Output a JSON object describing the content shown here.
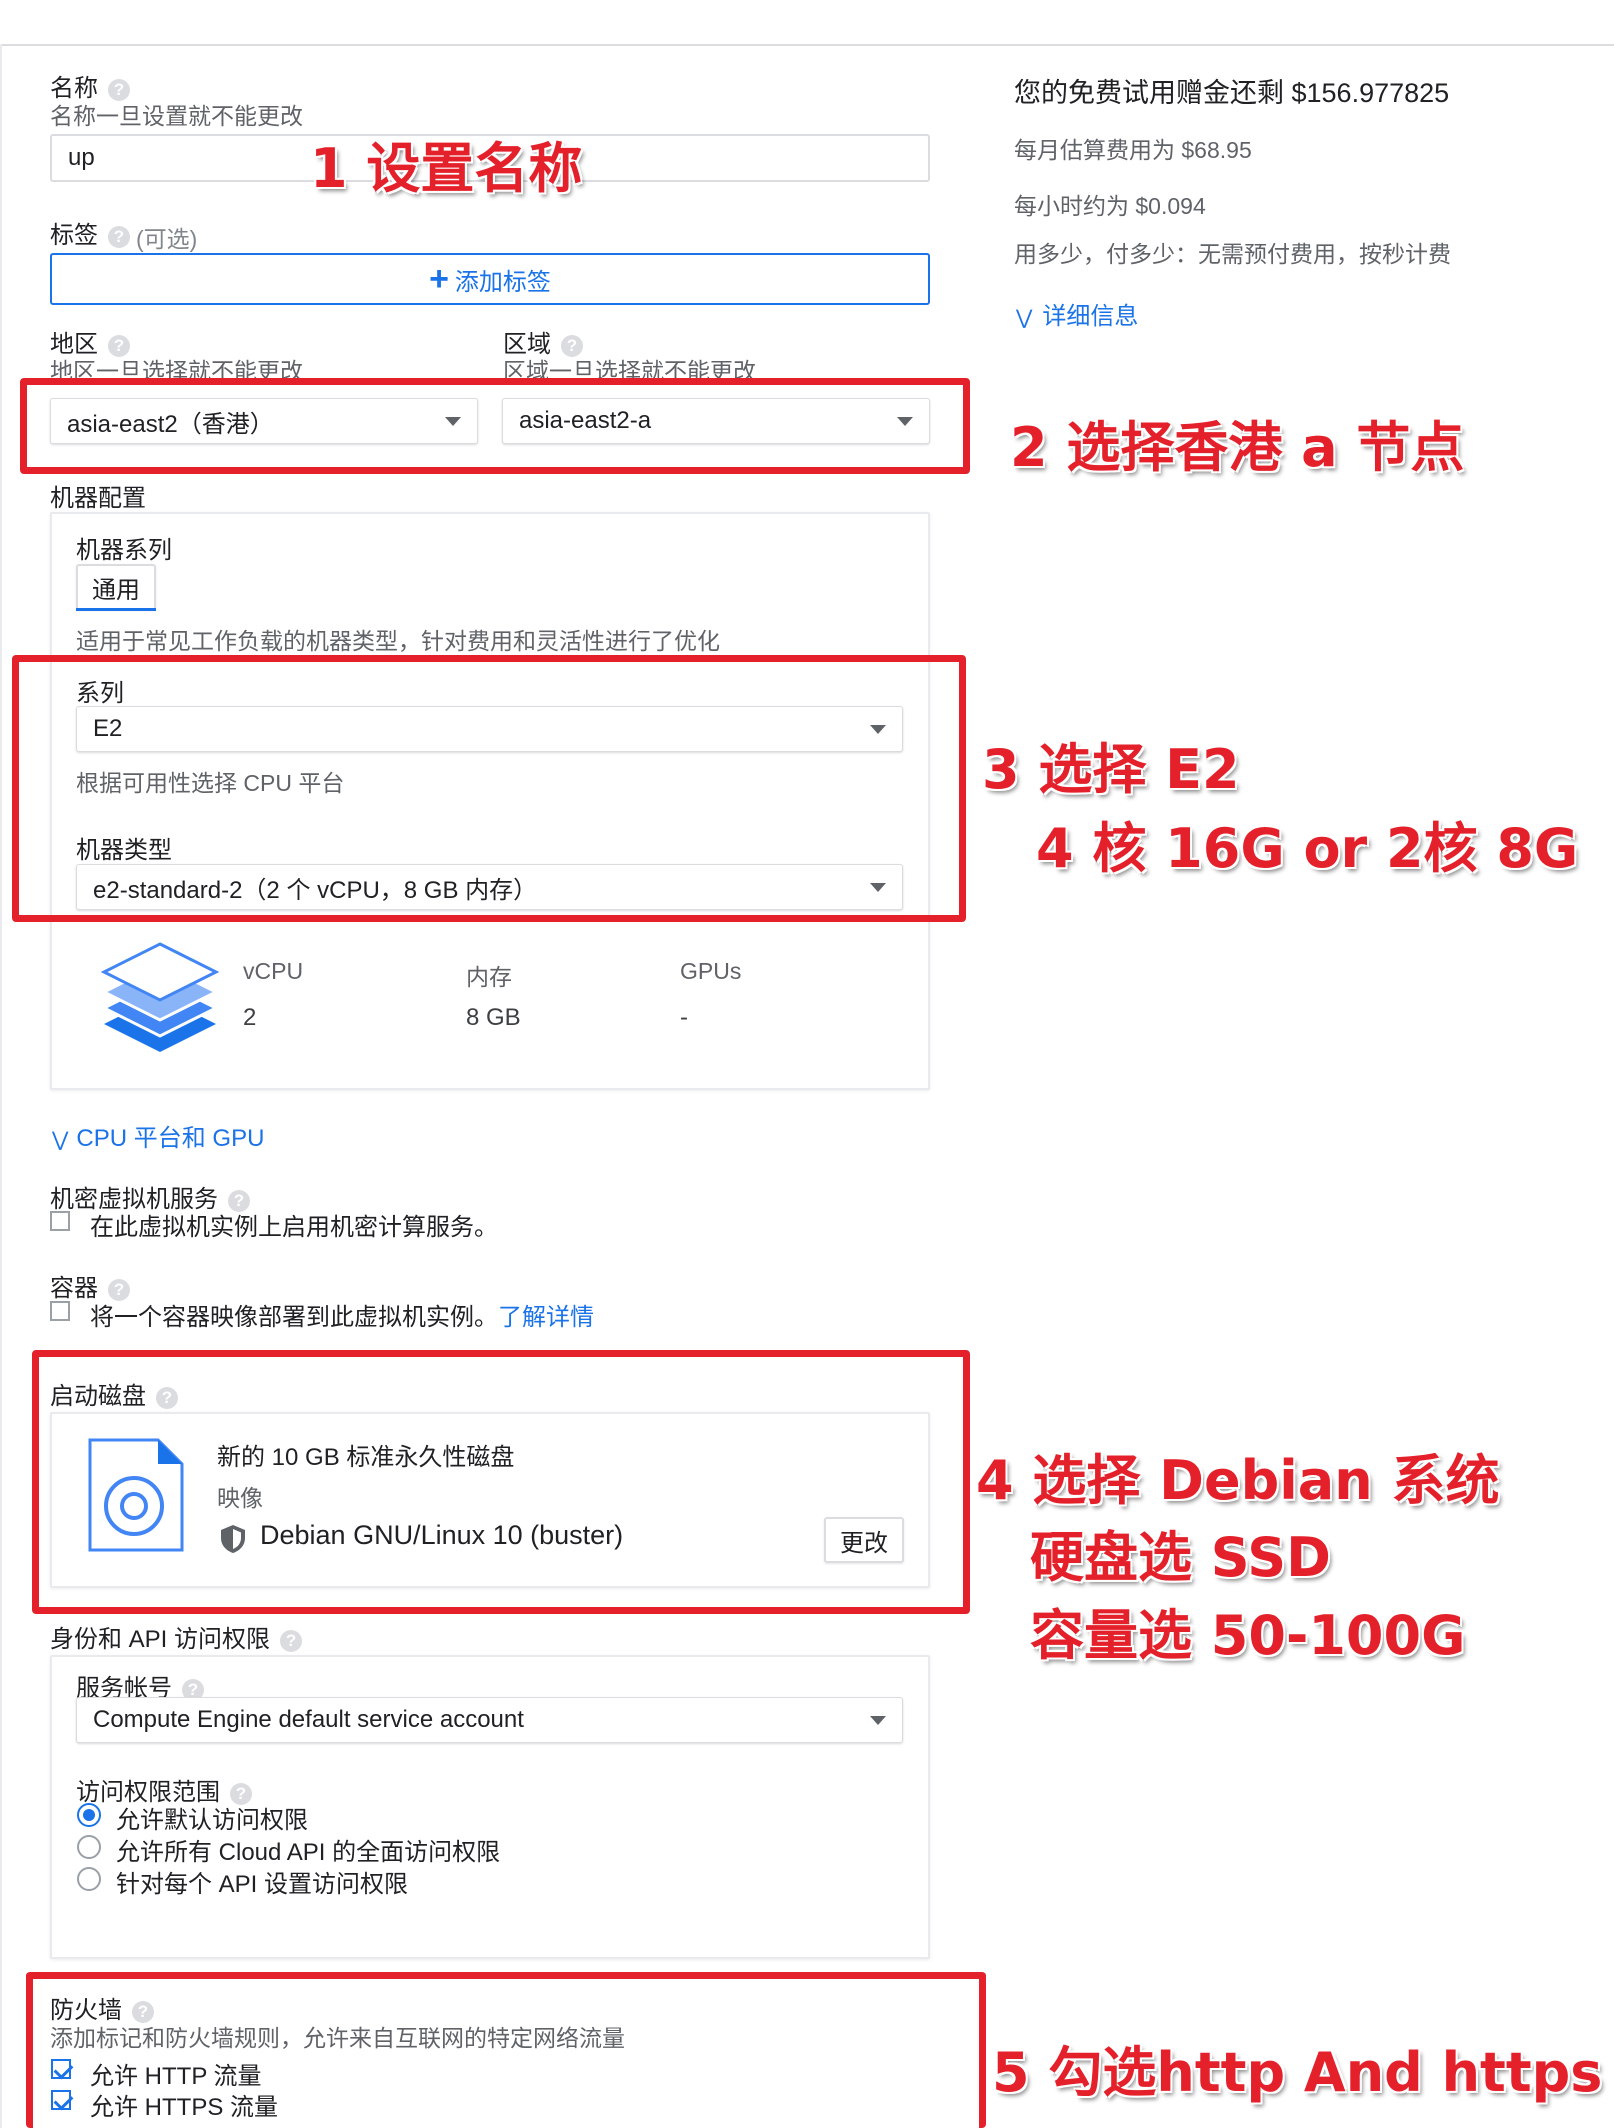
{
  "name": {
    "label": "名称",
    "hint": "名称一旦设置就不能更改",
    "value": "up"
  },
  "labels": {
    "label": "标签",
    "optional": "(可选)",
    "add_button": "添加标签"
  },
  "region": {
    "label": "地区",
    "hint": "地区一旦选择就不能更改",
    "value": "asia-east2（香港）"
  },
  "zone": {
    "label": "区域",
    "hint": "区域一旦选择就不能更改",
    "value": "asia-east2-a"
  },
  "machine_config": {
    "title": "机器配置",
    "family_label": "机器系列",
    "family_chip": "通用",
    "family_desc": "适用于常见工作负载的机器类型，针对费用和灵活性进行了优化",
    "series_label": "系列",
    "series_value": "E2",
    "series_hint": "根据可用性选择 CPU 平台",
    "type_label": "机器类型",
    "type_value": "e2-standard-2（2 个 vCPU，8 GB 内存）",
    "specs": {
      "vcpu_header": "vCPU",
      "vcpu_value": "2",
      "memory_header": "内存",
      "memory_value": "8 GB",
      "gpu_header": "GPUs",
      "gpu_value": "-"
    }
  },
  "cpu_platform_link": "CPU 平台和 GPU",
  "confidential": {
    "label": "机密虚拟机服务",
    "checkbox": "在此虚拟机实例上启用机密计算服务。"
  },
  "container": {
    "label": "容器",
    "checkbox": "将一个容器映像部署到此虚拟机实例。",
    "learn_more": "了解详情"
  },
  "boot_disk": {
    "label": "启动磁盘",
    "title": "新的 10 GB 标准永久性磁盘",
    "image_label": "映像",
    "image_value": "Debian GNU/Linux 10 (buster)",
    "change_button": "更改"
  },
  "identity": {
    "label": "身份和 API 访问权限",
    "service_account_label": "服务帐号",
    "service_account_value": "Compute Engine default service account",
    "scope_label": "访问权限范围",
    "scope_options": [
      "允许默认访问权限",
      "允许所有 Cloud API 的全面访问权限",
      "针对每个 API 设置访问权限"
    ],
    "selected_scope": 0
  },
  "firewall": {
    "label": "防火墙",
    "hint": "添加标记和防火墙规则，允许来自互联网的特定网络流量",
    "http": "允许 HTTP 流量",
    "https": "允许 HTTPS 流量"
  },
  "pricing": {
    "title": "您的免费试用赠金还剩 $156.977825",
    "monthly": "每月估算费用为 $68.95",
    "hourly": "每小时约为 $0.094",
    "note": "用多少，付多少：无需预付费用，按秒计费",
    "details_link": "详细信息"
  },
  "annotations": {
    "a1": "1 设置名称",
    "a2": "2 选择香港 a 节点",
    "a3_line1": "3 选择 E2",
    "a3_line2": "4 核 16G or 2核 8G",
    "a4_line1": "4 选择 Debian 系统",
    "a4_line2": "硬盘选 SSD",
    "a4_line3": "容量选 50-100G",
    "a5": "5 勾选http And https"
  },
  "colors": {
    "accent": "#1a73e8",
    "annotation_red": "#e4212b"
  }
}
